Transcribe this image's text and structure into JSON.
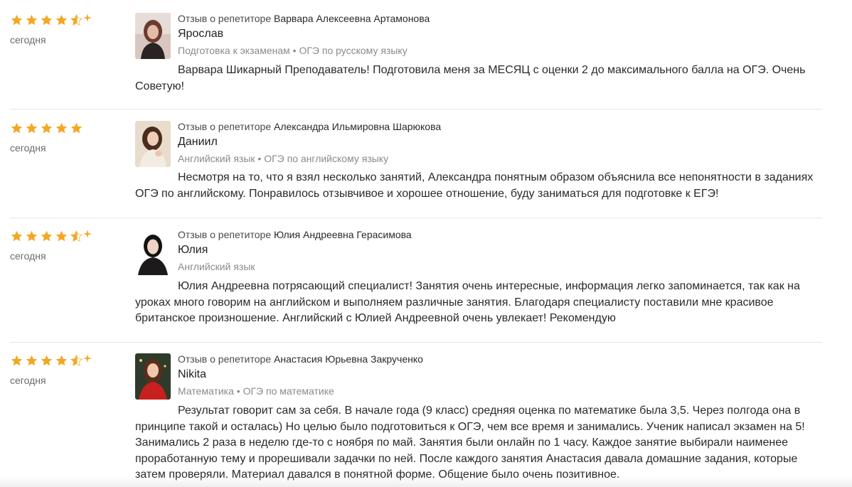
{
  "colors": {
    "star": "#f5a623",
    "star_empty": "#dddddd",
    "divider": "#e6e6e6"
  },
  "reviews": [
    {
      "rating": 4.5,
      "date": "сегодня",
      "tutor_prefix": "Отзыв о репетиторе",
      "tutor_name": "Варвара Алексеевна Артамонова",
      "author": "Ярослав",
      "subjects": "Подготовка к экзаменам • ОГЭ по русскому языку",
      "text": "Варвара Шикарный Преподаватель! Подготовила меня за МЕСЯЦ с оценки 2 до максимального балла на ОГЭ. Очень Советую!"
    },
    {
      "rating": 5,
      "date": "сегодня",
      "tutor_prefix": "Отзыв о репетиторе",
      "tutor_name": "Александра Ильмировна Шарюкова",
      "author": "Даниил",
      "subjects": "Английский язык • ОГЭ по английскому языку",
      "text": "Несмотря на то, что я взял несколько занятий, Александра понятным образом объяснила все непонятности в заданиях ОГЭ по английскому. Понравилось отзывчивое и хорошее отношение, буду заниматься для подготовке к ЕГЭ!"
    },
    {
      "rating": 4.5,
      "date": "сегодня",
      "tutor_prefix": "Отзыв о репетиторе",
      "tutor_name": "Юлия Андреевна Герасимова",
      "author": "Юлия",
      "subjects": "Английский язык",
      "text": "Юлия Андреевна потрясающий специалист! Занятия очень интересные, информация легко запоминается, так как на уроках много говорим на английском и выполняем различные занятия. Благодаря специалисту поставили мне красивое британское произношение. Английский с Юлией Андреевной очень увлекает! Рекомендую"
    },
    {
      "rating": 4.5,
      "date": "сегодня",
      "tutor_prefix": "Отзыв о репетиторе",
      "tutor_name": "Анастасия Юрьевна Закрученко",
      "author": "Nikita",
      "subjects": "Математика • ОГЭ по математике",
      "text": "Результат говорит сам за себя. В начале года (9 класс) средняя оценка по математике была 3,5. Через полгода она в принципе такой и осталась) Но целью было подготовиться к ОГЭ, чем все время и занимались. Ученик написал экзамен на 5! Занимались 2 раза в неделю где-то с ноября по май. Занятия были онлайн по 1 часу. Каждое занятие выбирали наименее проработанную тему и прорешивали задачки по ней. После каждого занятия Анастасия давала домашние задания, которые затем проверяли. Материал давался в понятной форме. Общение было очень позитивное."
    }
  ]
}
